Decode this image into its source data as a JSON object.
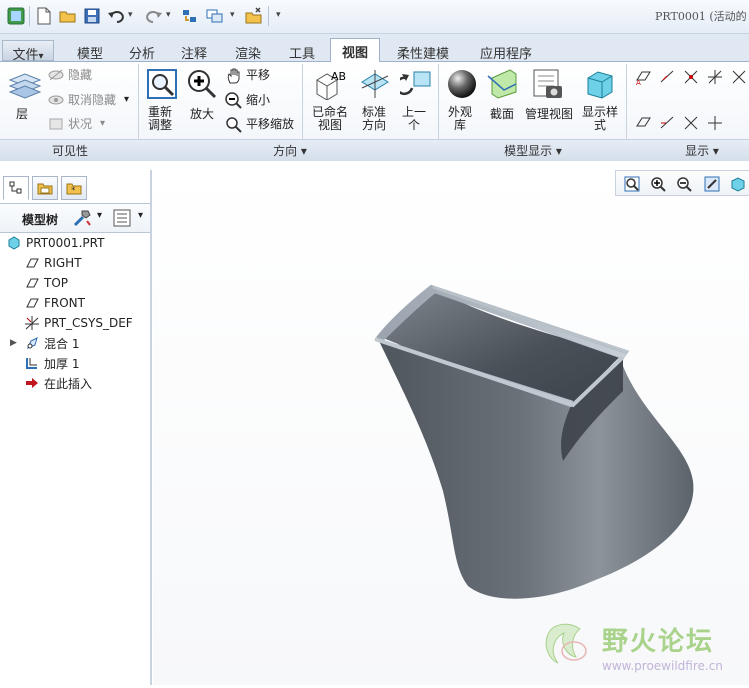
{
  "window": {
    "title": "PRT0001  (活动的"
  },
  "quick_access": {
    "icons": [
      "new-icon",
      "open-icon",
      "save-icon",
      "undo-icon",
      "redo-icon",
      "regenerate-icon",
      "windows-icon",
      "close-window-icon",
      "customize-icon"
    ]
  },
  "tabs": [
    {
      "label": "文件",
      "dropdown": "▾"
    },
    {
      "label": "模型"
    },
    {
      "label": "分析"
    },
    {
      "label": "注释"
    },
    {
      "label": "渲染"
    },
    {
      "label": "工具"
    },
    {
      "label": "视图",
      "active": true
    },
    {
      "label": "柔性建模"
    },
    {
      "label": "应用程序"
    }
  ],
  "ribbon": {
    "visibility": {
      "layer": "层",
      "hide": "隐藏",
      "unhide": "取消隐藏",
      "status": "状况",
      "group_label": "可见性"
    },
    "orientation": {
      "refit": "重新\n调整",
      "zoom_in": "放大",
      "pan": "平移",
      "zoom_out": "缩小",
      "pan_zoom": "平移缩放",
      "named_views": "已命名\n视图",
      "standard_orientation": "标准\n方向",
      "previous": "上一\n个",
      "group_label": "方向 ▾"
    },
    "model_display": {
      "appearance": "外观\n库",
      "section": "截面",
      "view_manager": "管理视图",
      "display_style": "显示样\n式",
      "group_label": "模型显示 ▾"
    },
    "display": {
      "group_label": "显示 ▾"
    }
  },
  "navigator": {
    "model_tree_label": "模型树",
    "items": [
      {
        "label": "PRT0001.PRT",
        "icon": "part-icon"
      },
      {
        "label": "RIGHT",
        "icon": "datum-plane-icon"
      },
      {
        "label": "TOP",
        "icon": "datum-plane-icon"
      },
      {
        "label": "FRONT",
        "icon": "datum-plane-icon"
      },
      {
        "label": "PRT_CSYS_DEF",
        "icon": "csys-icon"
      },
      {
        "label": "混合 1",
        "icon": "blend-icon",
        "expander": "▶"
      },
      {
        "label": "加厚 1",
        "icon": "thicken-icon"
      },
      {
        "label": "在此插入",
        "icon": "insert-here-arrow-icon"
      }
    ]
  },
  "watermark": {
    "text": "野火论坛",
    "url": "www.proewildfire.cn"
  },
  "colors": {
    "active_tab": "#ffffff",
    "model_surface": "#5a6068",
    "accent": "#2e6fb5",
    "watermark_green": "#9ccb7a"
  }
}
